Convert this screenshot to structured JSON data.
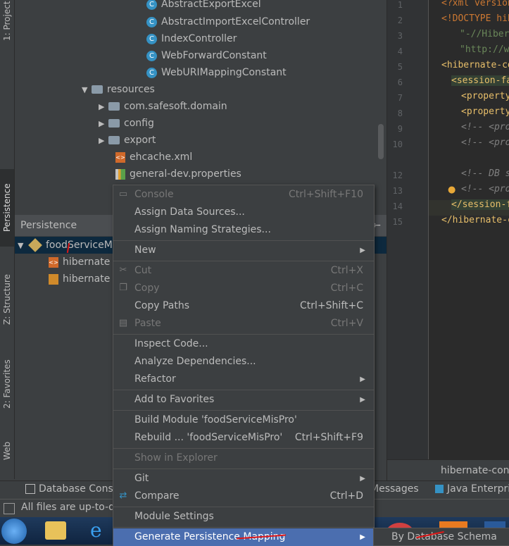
{
  "left_stripe": {
    "tabs": [
      {
        "label": "1: Project"
      },
      {
        "label": "Persistence"
      },
      {
        "label": "Z: Structure"
      },
      {
        "label": "2: Favorites"
      },
      {
        "label": "Web"
      }
    ]
  },
  "project_tree": {
    "items": [
      {
        "label": "AbstractExportExcel",
        "icon": "class-icon"
      },
      {
        "label": "AbstractImportExcelController",
        "icon": "class-icon"
      },
      {
        "label": "IndexController",
        "icon": "class-icon"
      },
      {
        "label": "WebForwardConstant",
        "icon": "class-icon"
      },
      {
        "label": "WebURIMappingConstant",
        "icon": "class-icon"
      },
      {
        "label": "resources",
        "icon": "folder-icon"
      },
      {
        "label": "com.safesoft.domain",
        "icon": "package-icon"
      },
      {
        "label": "config",
        "icon": "folder-icon"
      },
      {
        "label": "export",
        "icon": "folder-icon"
      },
      {
        "label": "ehcache.xml",
        "icon": "xml-icon"
      },
      {
        "label": "general-dev.properties",
        "icon": "properties-icon"
      }
    ]
  },
  "persistence": {
    "title": "Persistence",
    "items": [
      {
        "label": "foodServiceM"
      },
      {
        "label": "hibernate"
      },
      {
        "label": "hibernate"
      }
    ]
  },
  "editor": {
    "line_numbers": [
      "1",
      "2",
      "3",
      "4",
      "5",
      "6",
      "7",
      "8",
      "9",
      "10",
      "12",
      "13",
      "14",
      "15"
    ],
    "lines": [
      "<?xml version",
      "<!DOCTYPE hiber",
      "\"-//Hiber",
      "\"http://w",
      "<hibernate-co",
      "<session-fa",
      "<property",
      "<property",
      "<!-- <prop",
      "<!-- <prop",
      "<!-- DB sc",
      "<!-- <prop",
      "</session-f",
      "</hibernate-c"
    ],
    "tab_label": "hibernate-con"
  },
  "context_menu": {
    "items": [
      {
        "label": "Console",
        "shortcut": "Ctrl+Shift+F10"
      },
      {
        "label": "Assign Data Sources..."
      },
      {
        "label": "Assign Naming Strategies..."
      },
      {
        "label": "New"
      },
      {
        "label": "Cut",
        "shortcut": "Ctrl+X"
      },
      {
        "label": "Copy",
        "shortcut": "Ctrl+C"
      },
      {
        "label": "Copy Paths",
        "shortcut": "Ctrl+Shift+C"
      },
      {
        "label": "Paste",
        "shortcut": "Ctrl+V"
      },
      {
        "label": "Inspect Code..."
      },
      {
        "label": "Analyze Dependencies..."
      },
      {
        "label": "Refactor"
      },
      {
        "label": "Add to Favorites"
      },
      {
        "label": "Build Module 'foodServiceMisPro'"
      },
      {
        "label": "Rebuild ... 'foodServiceMisPro'",
        "shortcut": "Ctrl+Shift+F9"
      },
      {
        "label": "Show in Explorer"
      },
      {
        "label": "Git"
      },
      {
        "label": "Compare",
        "shortcut": "Ctrl+D"
      },
      {
        "label": "Module Settings"
      },
      {
        "label": "Generate Persistence Mapping"
      }
    ]
  },
  "submenu": {
    "label": "By Database Schema"
  },
  "bottom_bar": {
    "database_console": "Database Conso",
    "messages": "Messages",
    "java_enterprise": "Java Enterpri"
  },
  "status_bar": {
    "text": "All files are up-to-d"
  },
  "colors": {
    "background": "#3c3f41",
    "editor_bg": "#2b2b2b",
    "highlight": "#4b6eaf",
    "selection": "#0d293e"
  }
}
